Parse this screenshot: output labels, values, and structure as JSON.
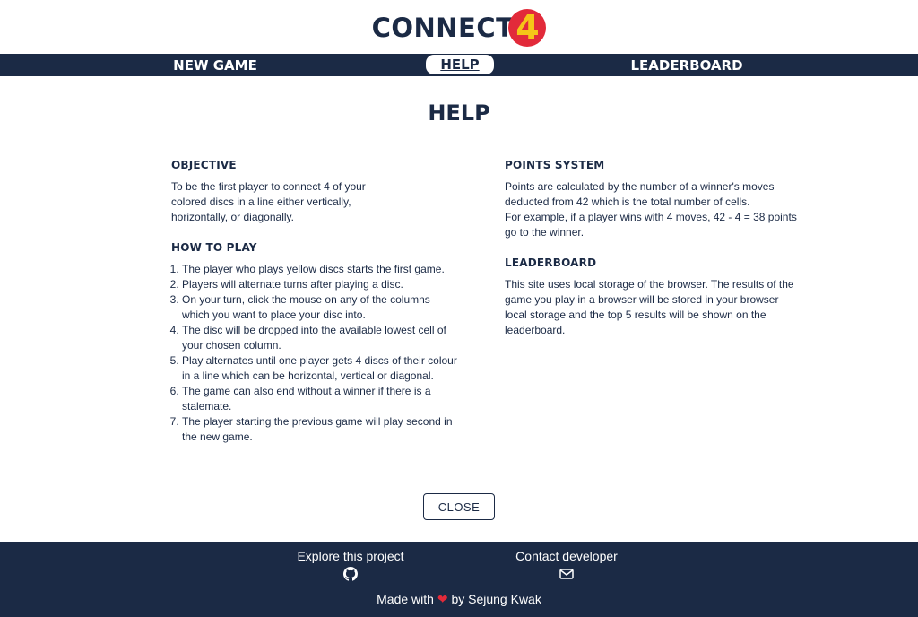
{
  "logo": {
    "text": "CONNECT",
    "number": "4"
  },
  "nav": {
    "new_game": "NEW GAME",
    "help": "HELP",
    "leaderboard": "LEADERBOARD"
  },
  "page_title": "HELP",
  "objective": {
    "title": "OBJECTIVE",
    "lines": [
      "To be the first player to connect 4 of your",
      "colored discs in a line either vertically,",
      "horizontally, or diagonally."
    ]
  },
  "how_to_play": {
    "title": "HOW TO PLAY",
    "steps": [
      "The player who plays yellow discs starts the first game.",
      "Players will alternate turns after playing a disc.",
      "On your turn, click the mouse on any of the columns which you want to place your disc into.",
      "The disc will be dropped into the available lowest cell of your chosen column.",
      "Play alternates until one player gets 4 discs of their colour in a line which can be horizontal, vertical or diagonal.",
      "The game can also end without a winner if there is a stalemate.",
      "The player starting the previous game will play second in the new game."
    ]
  },
  "points_system": {
    "title": "POINTS SYSTEM",
    "para1": "Points are calculated by the number of a winner's moves deducted from 42 which is the total number of cells.",
    "para2": "For example, if a player wins with 4 moves, 42 - 4 = 38 points go to the winner."
  },
  "leaderboard_info": {
    "title": "LEADERBOARD",
    "text": "This site uses local storage of the browser. The results of the game you play in a browser will be stored in your browser local storage and the top 5 results will be shown on the leaderboard."
  },
  "close_label": "CLOSE",
  "footer": {
    "explore": "Explore this project",
    "explore_icon": "github-icon",
    "contact": "Contact developer",
    "contact_icon": "envelope-icon",
    "made_prefix": "Made with",
    "heart": "❤",
    "made_suffix": "by Sejung Kwak"
  },
  "colors": {
    "navy": "#1b2a45",
    "red": "#e22a3a",
    "yellow": "#f5c518"
  }
}
